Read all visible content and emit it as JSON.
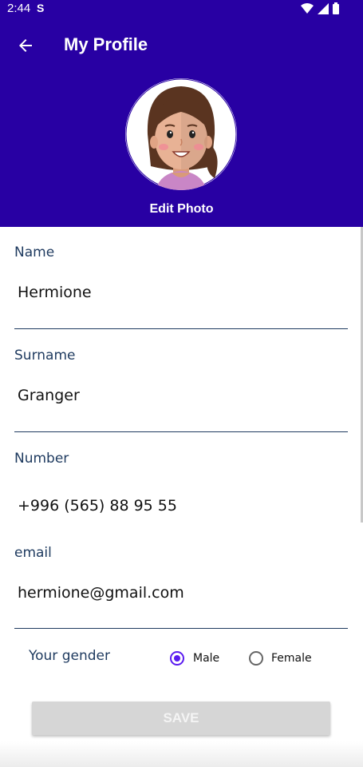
{
  "status_bar": {
    "time": "2:44",
    "app_badge": "S"
  },
  "toolbar": {
    "title": "My Profile"
  },
  "profile": {
    "edit_photo": "Edit Photo"
  },
  "fields": {
    "name": {
      "label": "Name",
      "value": "Hermione"
    },
    "surname": {
      "label": "Surname",
      "value": "Granger"
    },
    "number": {
      "label": "Number",
      "value": "+996 (565) 88 95 55"
    },
    "email": {
      "label": "email",
      "value": "hermione@gmail.com"
    }
  },
  "gender": {
    "label": "Your gender",
    "options": [
      {
        "label": "Male",
        "selected": true
      },
      {
        "label": "Female",
        "selected": false
      }
    ]
  },
  "save_button": {
    "label": "SAVE"
  },
  "colors": {
    "header": "#2800a3",
    "accent": "#5b1cf0",
    "field_text": "#1e3a5f"
  }
}
